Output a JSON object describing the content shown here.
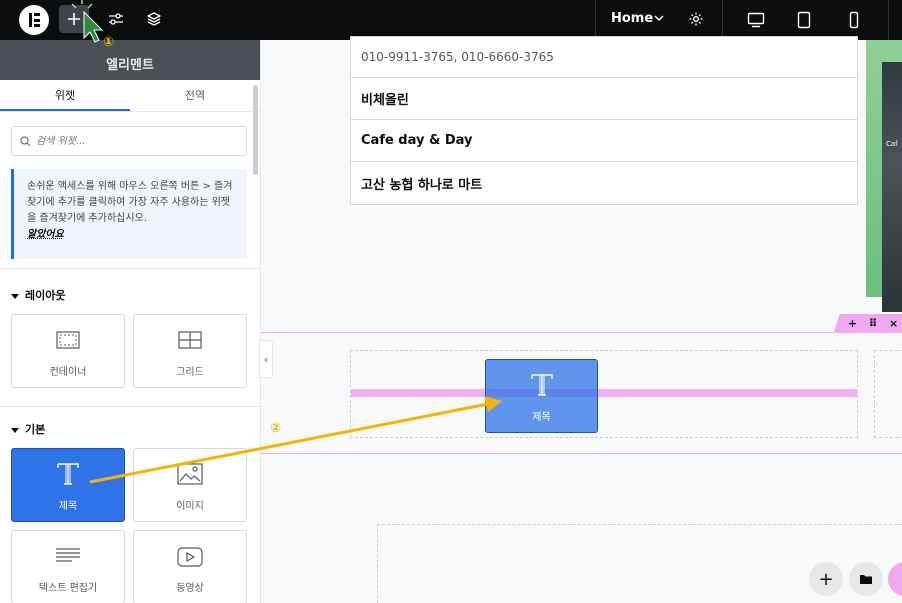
{
  "topbar": {
    "page_select": "Home",
    "device_modes": [
      "desktop",
      "tablet",
      "mobile"
    ]
  },
  "sidebar": {
    "title": "엘리멘트",
    "tabs": [
      {
        "label": "위젯",
        "active": true
      },
      {
        "label": "전역",
        "active": false
      }
    ],
    "search_placeholder": "검색 위젯...",
    "notice_text": "손쉬운 액세스를 위해 마우스 오른쪽 버튼 > 즐겨찾기에 추가를 클릭하여 가장 자주 사용하는 위젯을 즐겨찾기에 추가하십시오.",
    "notice_link": "알았어요",
    "categories": {
      "layout": "레이아웃",
      "basic": "기본"
    },
    "widgets": {
      "container": "컨테이너",
      "grid": "그리드",
      "heading": "제목",
      "image": "이미지",
      "text_editor": "텍스트 편집기",
      "video": "동영상"
    }
  },
  "canvas": {
    "table_rows": [
      {
        "text": "010-9911-3765, 010-6660-3765",
        "style": "plain"
      },
      {
        "text": "비체올린",
        "style": "bold"
      },
      {
        "text": "Cafe day & Day",
        "style": "bold"
      },
      {
        "text": "고산 농협 하나로 마트",
        "style": "bold"
      }
    ],
    "photo_sign": "Caf",
    "drag_widget_label": "제목"
  },
  "annotations": {
    "step1": "①",
    "step2": "②",
    "arrow_color": "#f5b400"
  },
  "colors": {
    "accent": "#2e73e8",
    "section_highlight": "#f0a8f0",
    "topbar": "#0c0d0e"
  }
}
